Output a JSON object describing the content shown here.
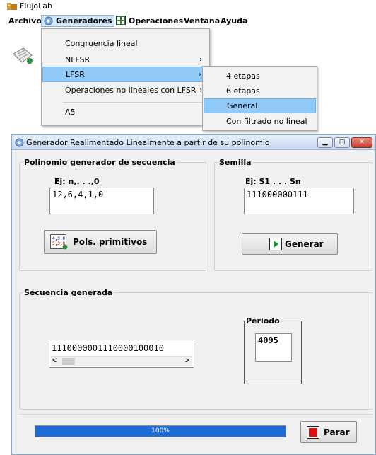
{
  "app": {
    "title": "FlujoLab"
  },
  "menubar": {
    "items": [
      {
        "label": "Archivo"
      },
      {
        "label": "Generadores"
      },
      {
        "label": "Operaciones"
      },
      {
        "label": "Ventana"
      },
      {
        "label": "Ayuda"
      }
    ]
  },
  "dropdown": {
    "items": [
      {
        "label": "Congruencia lineal",
        "has_submenu": false
      },
      {
        "label": "NLFSR",
        "has_submenu": true
      },
      {
        "label": "LFSR",
        "has_submenu": true,
        "highlighted": true
      },
      {
        "label": "Operaciones no lineales con LFSR",
        "has_submenu": true
      },
      {
        "label": "A5",
        "has_submenu": false
      }
    ],
    "arrow": "›"
  },
  "submenu": {
    "items": [
      {
        "label": "4 etapas"
      },
      {
        "label": "6 etapas"
      },
      {
        "label": "General",
        "highlighted": true
      },
      {
        "label": "Con filtrado no lineal"
      }
    ]
  },
  "dialog": {
    "title": "Generador Realimentado Linealmente a partir de su polinomio",
    "poly_group": {
      "legend": "Polinomio generador de secuencia",
      "hint": "Ej: n,. . .,0",
      "value": "12,6,4,1,0",
      "button_label": "Pols. primitivos",
      "button_icon_lines": [
        "4,3,0",
        "5,3,0"
      ]
    },
    "seed_group": {
      "legend": "Semilla",
      "hint": "Ej: S1 . . . Sn",
      "value": "111000000111",
      "button_label": "Generar"
    },
    "seq_group": {
      "legend": "Secuencia generada",
      "value": "1110000001110000100010",
      "scroll_left": "<",
      "scroll_right": ">"
    },
    "period": {
      "legend": "Periodo",
      "value": "4095"
    },
    "progress": {
      "text": "100%",
      "fraction": 1.0
    },
    "stop_button_label": "Parar"
  },
  "colors": {
    "progress": "#1e6bd6",
    "highlight": "#91c9f7",
    "stop": "#e01010",
    "play": "#109a2a"
  }
}
